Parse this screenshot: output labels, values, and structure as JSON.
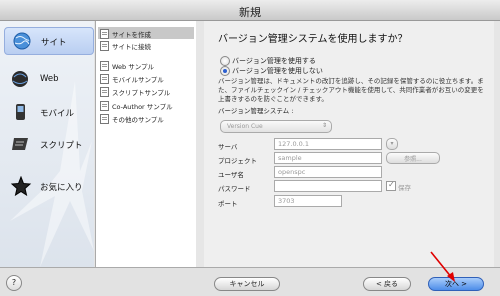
{
  "window": {
    "title": "新規"
  },
  "categories": [
    {
      "label": "サイト",
      "icon": "globe-icon",
      "selected": true
    },
    {
      "label": "Web",
      "icon": "web-globe-icon",
      "selected": false
    },
    {
      "label": "モバイル",
      "icon": "mobile-phone-icon",
      "selected": false
    },
    {
      "label": "スクリプト",
      "icon": "script-icon",
      "selected": false
    },
    {
      "label": "お気に入り",
      "icon": "favorite-star-icon",
      "selected": false
    }
  ],
  "templates": [
    {
      "label": "サイトを作成",
      "selected": true
    },
    {
      "label": "サイトに接続",
      "selected": false
    },
    {
      "label": "Web サンプル",
      "selected": false
    },
    {
      "label": "モバイルサンプル",
      "selected": false
    },
    {
      "label": "スクリプトサンプル",
      "selected": false
    },
    {
      "label": "Co-Author サンプル",
      "selected": false
    },
    {
      "label": "その他のサンプル",
      "selected": false
    }
  ],
  "panel": {
    "heading": "バージョン管理システムを使用しますか？",
    "radio_use": "バージョン管理を使用する",
    "radio_nouse": "バージョン管理を使用しない",
    "radio_selected": "nouse",
    "description": "バージョン管理は、ドキュメントの改訂を追跡し、その記録を保管するのに役立ちます。また、ファイルチェックイン / チェックアウト機能を使用して、共同作業者がお互いの変更を上書きするのを防ぐことができます。",
    "vcs_label": "バージョン管理システム :",
    "vcs_value": "Version Cue",
    "server_label": "サーバ",
    "server_value": "127.0.0.1",
    "project_label": "プロジェクト",
    "project_value": "sample",
    "browse_label": "参照...",
    "user_label": "ユーザ名",
    "user_value": "openspc",
    "password_label": "パスワード",
    "password_value": "",
    "save_label": "保存",
    "port_label": "ポート",
    "port_value": "3703"
  },
  "footer": {
    "help": "?",
    "cancel": "キャンセル",
    "back": "< 戻る",
    "next": "次へ >"
  }
}
